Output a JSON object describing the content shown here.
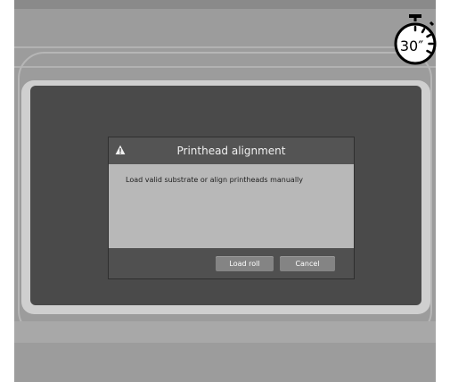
{
  "dialog": {
    "title": "Printhead alignment",
    "message": "Load valid substrate or align printheads manually",
    "buttons": {
      "load_roll": "Load roll",
      "cancel": "Cancel"
    }
  },
  "timer": {
    "label": "30″"
  },
  "icons": {
    "warning": "warning-icon",
    "timer": "stopwatch-icon"
  },
  "colors": {
    "screen": "#4a4a4a",
    "dialog_title_bar": "#545454",
    "dialog_body": "#b8b8b8",
    "button": "#848484"
  }
}
